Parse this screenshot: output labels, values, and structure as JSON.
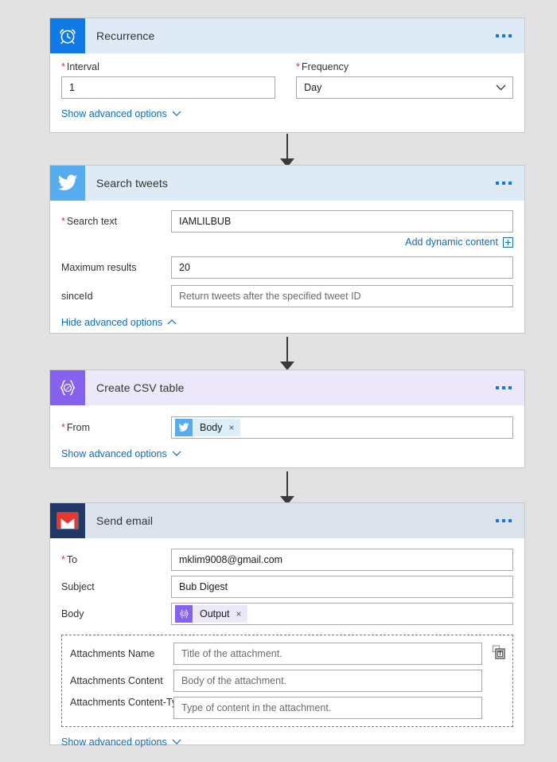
{
  "flow": {
    "background_color": "#e2e2e2",
    "accent_link_color": "#0f6cbd",
    "required_marker": "*"
  },
  "cards": [
    {
      "id": "recurrence",
      "title": "Recurrence",
      "icon_name": "alarm-clock-icon",
      "icon_bg": "#0f7ae5",
      "header_bg": "#deeaf6",
      "more_label": "…",
      "fields": {
        "interval_label": "Interval",
        "interval_value": "1",
        "frequency_label": "Frequency",
        "frequency_value": "Day"
      },
      "advanced_link": "Show advanced options"
    },
    {
      "id": "search-tweets",
      "title": "Search tweets",
      "icon_name": "twitter-bird-icon",
      "icon_bg": "#55acee",
      "header_bg": "#deeaf6",
      "fields": {
        "search_text_label": "Search text",
        "search_text_value": "IAMLILBUB",
        "dynamic_content_link": "Add dynamic content",
        "max_results_label": "Maximum results",
        "max_results_value": "20",
        "since_id_label": "sinceId",
        "since_id_placeholder": "Return tweets after the specified tweet ID"
      },
      "advanced_link": "Hide advanced options"
    },
    {
      "id": "create-csv-table",
      "title": "Create CSV table",
      "icon_name": "data-operation-braces-icon",
      "icon_bg": "#8661f0",
      "header_bg": "#ece7f9",
      "fields": {
        "from_label": "From",
        "from_token": "Body",
        "from_token_source_icon": "twitter-bird-icon",
        "token_remove_label": "×"
      },
      "advanced_link": "Show advanced options"
    },
    {
      "id": "send-email",
      "title": "Send email",
      "icon_name": "gmail-envelope-icon",
      "icon_bg": "#1f3864",
      "header_bg": "#dbe2ec",
      "fields": {
        "to_label": "To",
        "to_value": "mklim9008@gmail.com",
        "subject_label": "Subject",
        "subject_value": "Bub Digest",
        "body_label": "Body",
        "body_token": "Output",
        "body_token_source_icon": "data-operation-braces-icon",
        "token_remove_label": "×",
        "attachments_name_label": "Attachments Name",
        "attachments_name_placeholder": "Title of the attachment.",
        "attachments_content_label": "Attachments Content",
        "attachments_content_placeholder": "Body of the attachment.",
        "attachments_content_type_label": "Attachments Content-Type",
        "attachments_content_type_placeholder": "Type of content in the attachment.",
        "attachments_delete_icon": "delete-trash-icon"
      },
      "advanced_link": "Show advanced options"
    }
  ]
}
